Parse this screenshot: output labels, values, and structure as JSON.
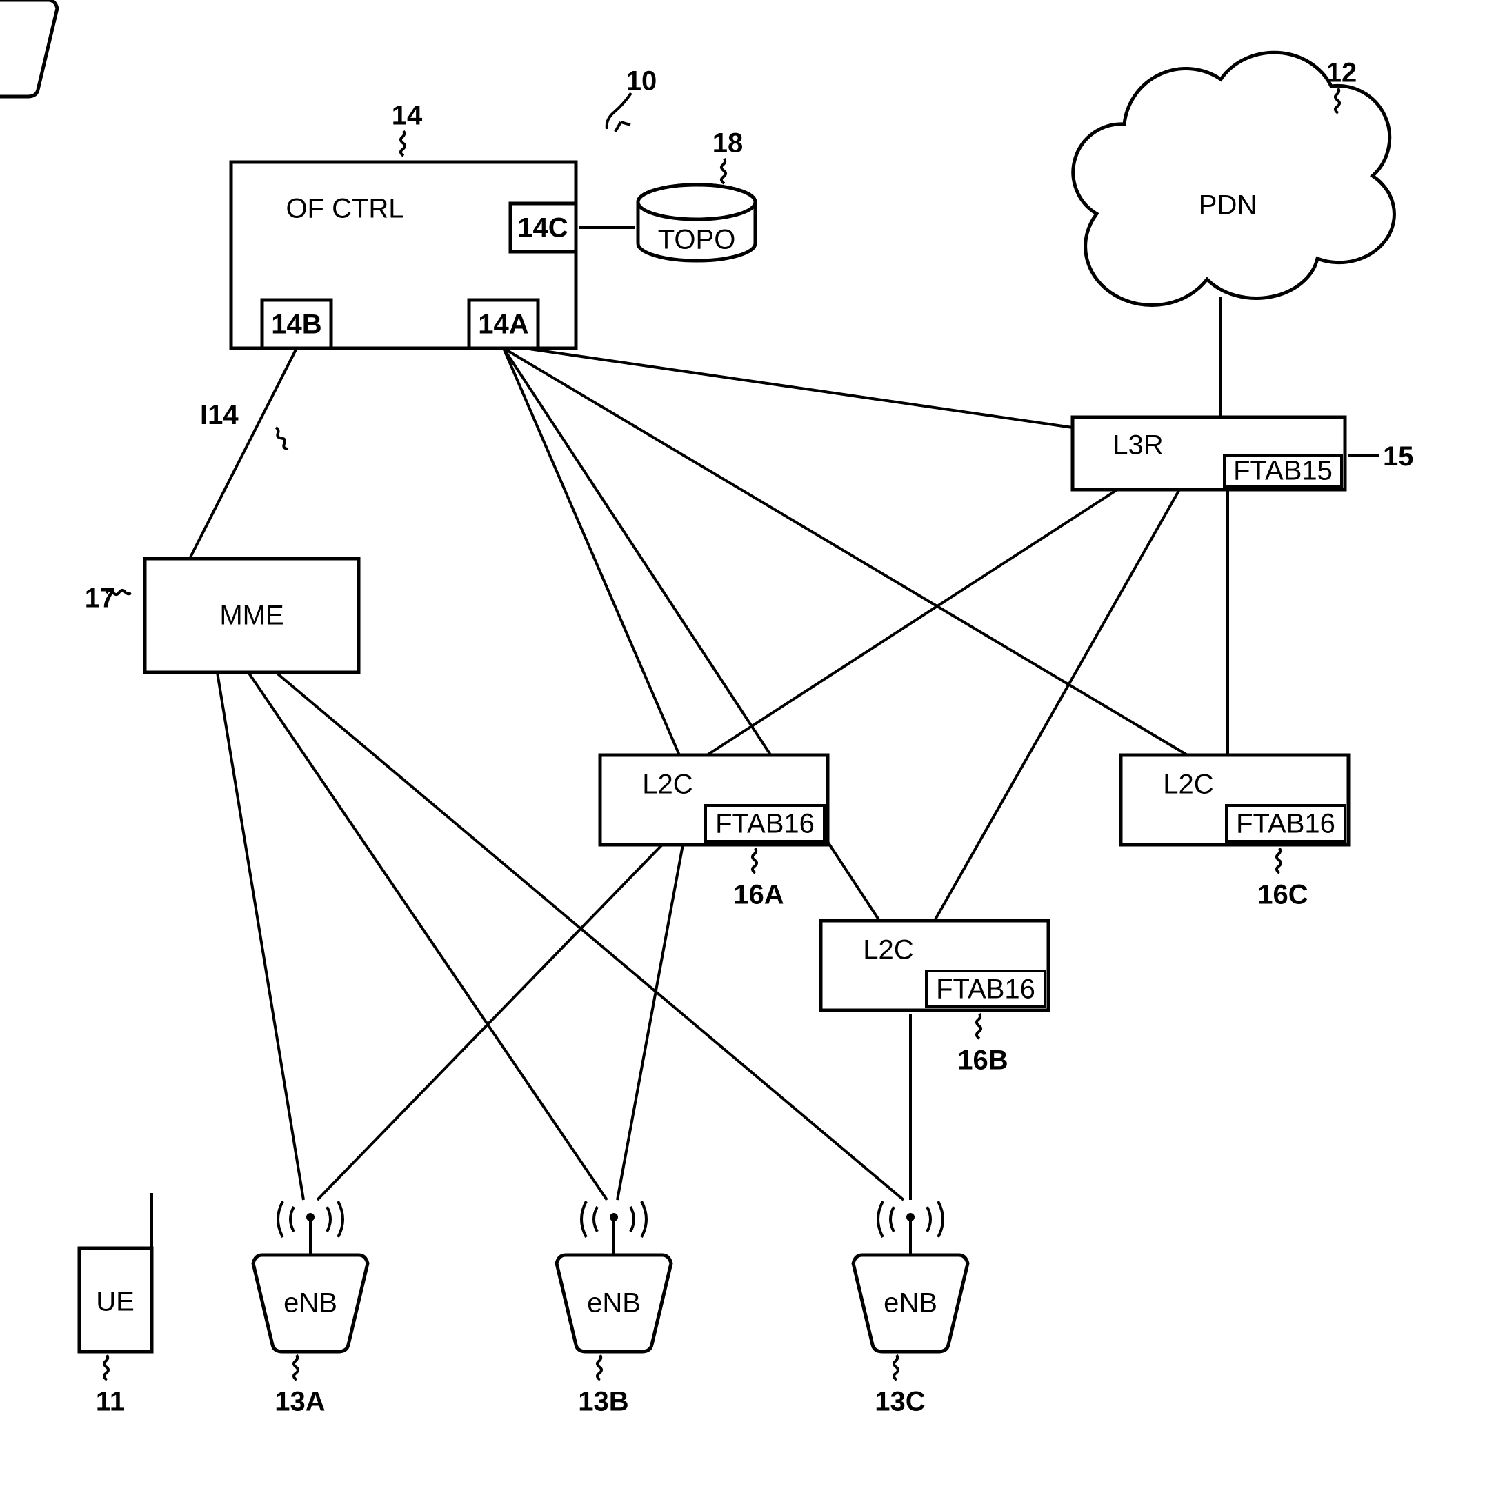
{
  "figure_ref": "10",
  "controller": {
    "ref": "14",
    "label": "OF CTRL",
    "ports": {
      "A": "14A",
      "B": "14B",
      "C": "14C"
    }
  },
  "topo_db": {
    "ref": "18",
    "label": "TOPO"
  },
  "pdn": {
    "ref": "12",
    "label": "PDN"
  },
  "l3r": {
    "ref": "15",
    "label": "L3R",
    "ftab": "FTAB15"
  },
  "mme": {
    "ref": "17",
    "label": "MME"
  },
  "link_ctrl_mme": "I14",
  "l2c": [
    {
      "ref": "16A",
      "label": "L2C",
      "ftab": "FTAB16"
    },
    {
      "ref": "16B",
      "label": "L2C",
      "ftab": "FTAB16"
    },
    {
      "ref": "16C",
      "label": "L2C",
      "ftab": "FTAB16"
    }
  ],
  "enb": [
    {
      "ref": "13A",
      "label": "eNB"
    },
    {
      "ref": "13B",
      "label": "eNB"
    },
    {
      "ref": "13C",
      "label": "eNB"
    }
  ],
  "ue": {
    "ref": "11",
    "label": "UE"
  }
}
